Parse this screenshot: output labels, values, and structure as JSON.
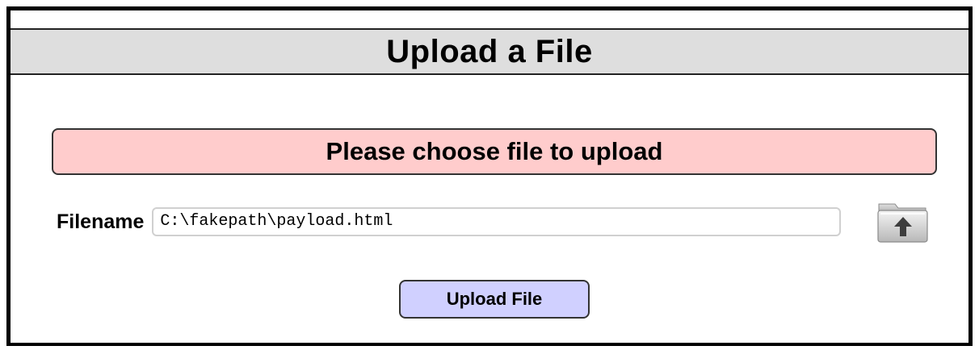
{
  "header": {
    "title": "Upload a File"
  },
  "alert": {
    "message": "Please choose file to upload",
    "background_color": "#ffcccc"
  },
  "file_field": {
    "label": "Filename",
    "value": "C:\\fakepath\\payload.html",
    "browse_icon": "folder-upload-icon"
  },
  "actions": {
    "upload_label": "Upload File",
    "upload_color": "#d0d0ff"
  },
  "colors": {
    "title_bar": "#dedede",
    "frame_border": "#000000"
  }
}
